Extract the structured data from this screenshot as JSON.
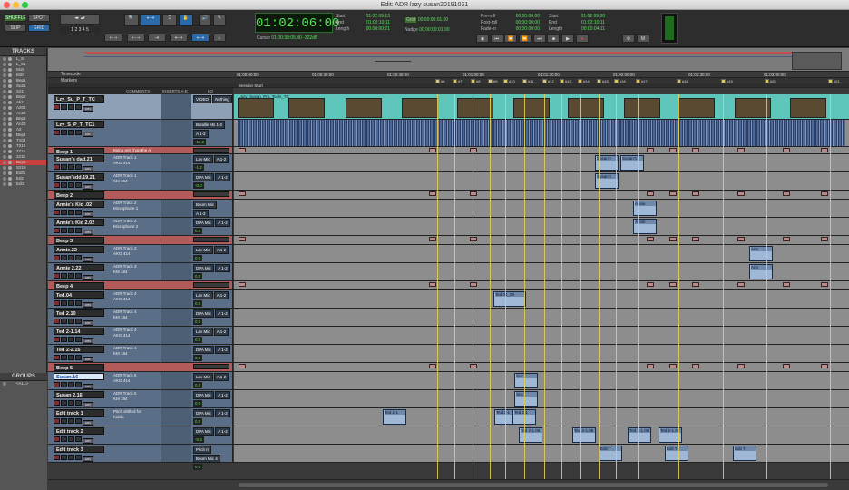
{
  "window": {
    "title": "Edit: ADR lazy susan20191031"
  },
  "toolbar": {
    "shuffle": "SHUFFLE",
    "spot": "SPOT",
    "slip": "SLIP",
    "grid": "GRID",
    "cursor_labels": [
      "1",
      "2",
      "3",
      "4",
      "5"
    ],
    "main_counter": "01:02:06:00",
    "start_label": "Start",
    "end_label": "End",
    "length_label": "Length",
    "start": "01:02:09:13",
    "end": "01:02:10:11",
    "length": "00:00:00:21",
    "cursor_label": "Cursor",
    "cursor_value": "01:00:38:05.00",
    "cursor_extra": "-322dB",
    "grid_value": "00:00:00:01.00",
    "nudge_value": "00:00:00:01.00",
    "grid_label": "Grid",
    "nudge_label": "Nudge",
    "preroll_label": "Pre-roll",
    "postroll_label": "Post-roll",
    "fadein_label": "Fade-in",
    "preroll": "00:00:00:00",
    "postroll": "00:00:00:00",
    "fadein": "00:00:00:00",
    "trans_start_label": "Start",
    "trans_end_label": "End",
    "trans_length_label": "Length",
    "trans_start": "01:02:09:00",
    "trans_end": "01:02:10:11",
    "trans_length": "00:00:04:11",
    "qty_label": "Qty"
  },
  "sidebar": {
    "tracks_header": "TRACKS",
    "groups_header": "GROUPS",
    "track_names": [
      "L_S",
      "L_S1",
      "M15",
      "M20",
      "Bep1",
      "Su21",
      "S21",
      "Bep2",
      "Ak2",
      "A202",
      "An22",
      "Bep3",
      "An22",
      "A2",
      "Bep4",
      "T104",
      "T210",
      "221a",
      "221b",
      "Bep5",
      "S216",
      "Edit1",
      "Ed2",
      "Edi3"
    ],
    "group_entry": "<ALL>"
  },
  "rulers": {
    "timecode_label": "Timecode",
    "markers_label": "Markers",
    "ticks": [
      "01:00:00:00",
      "01:00:30:00",
      "01:00:45:00",
      "01:01:00:00",
      "01:01:30:00",
      "01:02:00:00",
      "01:02:30:00",
      "01:03:00:00"
    ],
    "session_start": "Session Start",
    "marker_labels": [
      "#6",
      "#7",
      "#8",
      "#9",
      "#10",
      "#11",
      "#12",
      "#13",
      "#14",
      "#15",
      "#16",
      "#17",
      "#18",
      "#19",
      "#20",
      "#21"
    ]
  },
  "columns": {
    "comments": "COMMENTS",
    "inserts": "INSERTS A-E",
    "io": "I/O"
  },
  "tracks": [
    {
      "name": "Lzy_Su_P_T_TC",
      "kind": "video",
      "comment": "",
      "io1": "VIDEO",
      "io2": "Nothing",
      "vol": "",
      "clip": "Lazy_Susan_Pro_Tools_TC"
    },
    {
      "name": "Lzy_S_P_T_TC1",
      "kind": "audio",
      "comment": "",
      "io1": "Bundle Ms 1-2",
      "io2": "A 1-2",
      "vol": "-13.2",
      "clip": ""
    },
    {
      "name": "Beep 1",
      "kind": "beep",
      "comment": "Mono ent chop the A",
      "io1": "",
      "io2": "",
      "vol": "",
      "clip": ""
    },
    {
      "name": "Susan's dad.21",
      "kind": "audio",
      "comment": "ADR Track 1\nAKG 414",
      "io1": "Lav Mic",
      "io2": "A 1-2",
      "vol": "-1.2",
      "clip": "Susan's"
    },
    {
      "name": "Susan'sdd.19.21",
      "kind": "audio",
      "comment": "ADR Track 1\nKM 184",
      "io1": "DPA Mic",
      "io2": "A 1-2",
      "vol": "-0.0",
      "clip": "Susan's"
    },
    {
      "name": "Beep 2",
      "kind": "beep",
      "comment": "",
      "io1": "",
      "io2": "",
      "vol": "",
      "clip": ""
    },
    {
      "name": "Annie's Kid .02",
      "kind": "audio",
      "comment": "ADR Track 2\nMicrophone 1",
      "io1": "Boom Mic",
      "io2": "A 1-2",
      "vol": "0.0",
      "clip": "Annie"
    },
    {
      "name": "Annie's Kid 2.02",
      "kind": "audio",
      "comment": "ADR Track 2\nMicrophone 2",
      "io1": "DPA Mic",
      "io2": "A 1-2",
      "vol": "0.0",
      "clip": "Annie"
    },
    {
      "name": "Beep 3",
      "kind": "beep",
      "comment": "",
      "io1": "",
      "io2": "",
      "vol": "",
      "clip": ""
    },
    {
      "name": "Annie.22",
      "kind": "audio",
      "comment": "ADR Track 3\nAKG 414",
      "io1": "Lav Mic",
      "io2": "A 1-2",
      "vol": "0.0",
      "clip": "Ann"
    },
    {
      "name": "Annie 2.22",
      "kind": "audio",
      "comment": "ADR Track 3\nKM 184",
      "io1": "DPA Mic",
      "io2": "A 1-2",
      "vol": "0.0",
      "clip": "Ann"
    },
    {
      "name": "Beep 4",
      "kind": "beep",
      "comment": "",
      "io1": "",
      "io2": "",
      "vol": "",
      "clip": ""
    },
    {
      "name": "Ted.04",
      "kind": "audio",
      "comment": "ADR Track 4\nAKG 414",
      "io1": "Lav Mic",
      "io2": "A 1-2",
      "vol": "0.0",
      "clip": "Ted.04_03"
    },
    {
      "name": "Ted 2.10",
      "kind": "audio",
      "comment": "ADR Track 4\nKM 184",
      "io1": "DPA Mic",
      "io2": "A 1-2",
      "vol": "0.0",
      "clip": ""
    },
    {
      "name": "Ted 2-1.14",
      "kind": "audio",
      "comment": "ADR Track 4\nAKG 414",
      "io1": "Lav Mic",
      "io2": "A 1-2",
      "vol": "0.0",
      "clip": ""
    },
    {
      "name": "Ted 2-2.15",
      "kind": "audio",
      "comment": "ADR Track 4\nKM 184",
      "io1": "DPA Mic",
      "io2": "A 1-2",
      "vol": "0.0",
      "clip": ""
    },
    {
      "name": "Beep 5",
      "kind": "beep",
      "comment": "",
      "io1": "",
      "io2": "",
      "vol": "",
      "clip": ""
    },
    {
      "name": "Susan.16",
      "kind": "audio_sel",
      "comment": "ADR Track 5\nAKG 414",
      "io1": "Lav Mic",
      "io2": "A 1-2",
      "vol": "0.0",
      "clip": "Sus"
    },
    {
      "name": "Susan 2.16",
      "kind": "audio",
      "comment": "ADR Track 5\nKM 184",
      "io1": "DPA Mic",
      "io2": "A 1-2",
      "vol": "0.0",
      "clip": "Sus"
    },
    {
      "name": "Edit track 1",
      "kind": "audio",
      "comment": "Pitch shifted for\nKiddo",
      "io1": "DPA Mic",
      "io2": "A 1-2",
      "vol": "0.0",
      "clip": "Ted 2-1"
    },
    {
      "name": "Edit track 2",
      "kind": "audio",
      "comment": "",
      "io1": "DPA Mic",
      "io2": "A 1-2",
      "vol": "-0.5",
      "clip": "Ted 2-1.06"
    },
    {
      "name": "Edit track 3",
      "kind": "audio",
      "comment": "",
      "io1": "Pitch II",
      "io2": "Boom Mic 4",
      "vol": "0.0",
      "clip": "Edit T"
    }
  ],
  "colors": {
    "audio_track": "#5a6e88",
    "beep_track": "#b35a5a",
    "clip": "#9fb8d6",
    "marker_line": "#e1cd56",
    "video_lane": "#5ec5bb"
  }
}
